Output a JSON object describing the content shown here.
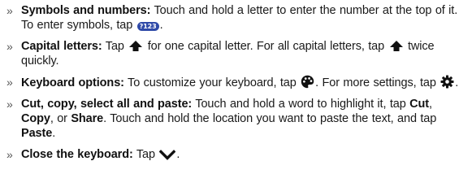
{
  "items": [
    {
      "title": "Symbols and numbers:",
      "t1": " Touch and hold a letter to enter the number at the top of it. To enter symbols, tap ",
      "badge": "?123",
      "t2": "."
    },
    {
      "title": "Capital letters:",
      "t1": " Tap ",
      "t2": " for one capital letter. For all capital letters, tap ",
      "t3": " twice quickly."
    },
    {
      "title": "Keyboard options:",
      "t1": " To customize your keyboard, tap ",
      "t2": ". For more settings, tap ",
      "t3": "."
    },
    {
      "title": "Cut, copy, select all and paste:",
      "t1": " Touch and hold a word to highlight it, tap ",
      "cut": "Cut",
      "sep1": ", ",
      "copy": "Copy",
      "sep2": ", or ",
      "share": "Share",
      "t2": ". Touch and hold the location you want to paste the text, and tap ",
      "paste": "Paste",
      "t3": "."
    },
    {
      "title": "Close the keyboard:",
      "t1": " Tap ",
      "t2": "."
    }
  ],
  "bullet_glyph": "»",
  "icons": {
    "badge": "keyboard-symbols-icon",
    "shift": "shift-arrow-icon",
    "palette": "palette-icon",
    "settings": "gear-icon",
    "close": "chevron-down-icon"
  }
}
